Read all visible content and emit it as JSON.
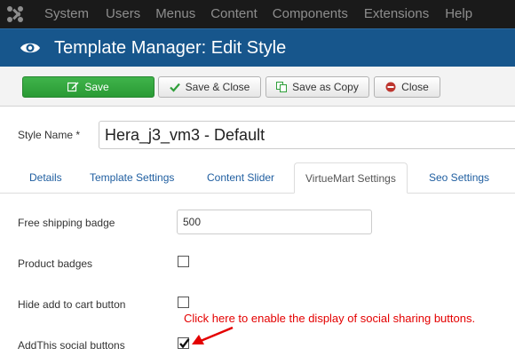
{
  "nav": {
    "items": [
      "System",
      "Users",
      "Menus",
      "Content",
      "Components",
      "Extensions",
      "Help"
    ]
  },
  "header": {
    "title": "Template Manager: Edit Style"
  },
  "toolbar": {
    "save_label": "Save",
    "save_close_label": "Save & Close",
    "save_copy_label": "Save as Copy",
    "close_label": "Close"
  },
  "form": {
    "style_name_label": "Style Name *",
    "style_name_value": "Hera_j3_vm3 - Default"
  },
  "tabs": [
    "Details",
    "Template Settings",
    "Content Slider",
    "VirtueMart Settings",
    "Seo Settings"
  ],
  "active_tab": "VirtueMart Settings",
  "fields": {
    "free_shipping_label": "Free shipping badge",
    "free_shipping_value": "500",
    "product_badges_label": "Product badges",
    "product_badges_checked": false,
    "hide_cart_label": "Hide add to cart button",
    "hide_cart_checked": false,
    "addthis_label": "AddThis social buttons",
    "addthis_checked": true
  },
  "annotation": {
    "text": "Click here to enable the display of social sharing buttons.",
    "color": "#e40000"
  },
  "colors": {
    "navbar": "#1a1a1a",
    "header": "#17568c",
    "save_button": "#2f9f3a",
    "tab_link": "#1f5ea0"
  },
  "icons": [
    "joomla-logo-icon",
    "eye-icon",
    "edit-icon",
    "check-icon",
    "copy-icon",
    "cancel-icon",
    "checkmark-icon",
    "arrow-icon"
  ]
}
